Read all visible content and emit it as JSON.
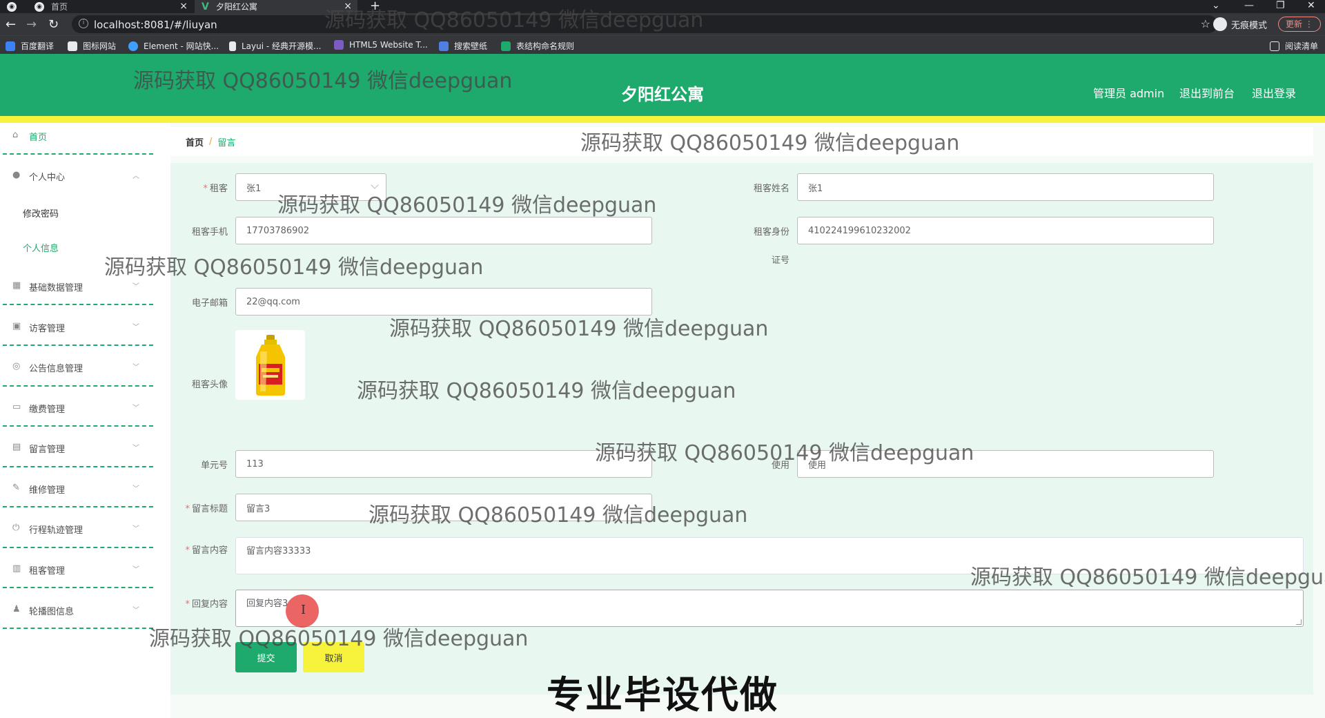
{
  "browser": {
    "tabs": [
      {
        "label": "首页",
        "icon": "globe-icon"
      },
      {
        "label": "夕阳红公寓",
        "icon": "vue-icon"
      }
    ],
    "url": "localhost:8081/#/liuyan",
    "incognito_label": "无痕模式",
    "update_label": "更新",
    "bookmarks": [
      {
        "label": "百度翻译",
        "color": "#3b82f6"
      },
      {
        "label": "图标网站",
        "color": "#e8eaed"
      },
      {
        "label": "Element - 网站快...",
        "color": "#409eff"
      },
      {
        "label": "Layui - 经典开源模...",
        "color": "#e8eaed"
      },
      {
        "label": "HTML5 Website T...",
        "color": "#7c5cc4"
      },
      {
        "label": "搜索壁纸",
        "color": "#4f7fe3"
      },
      {
        "label": "表结构命名规则",
        "color": "#1daa6c"
      }
    ],
    "reading_list": "阅读清单"
  },
  "header": {
    "title": "夕阳红公寓",
    "admin_label": "管理员 admin",
    "to_front_label": "退出到前台",
    "logout_label": "退出登录"
  },
  "sidebar": {
    "items": [
      {
        "label": "首页",
        "icon": "home-icon"
      },
      {
        "label": "个人中心",
        "icon": "user-icon"
      },
      {
        "label": "基础数据管理",
        "icon": "grid-icon"
      },
      {
        "label": "访客管理",
        "icon": "clipboard-icon"
      },
      {
        "label": "公告信息管理",
        "icon": "compass-icon"
      },
      {
        "label": "缴费管理",
        "icon": "chat-icon"
      },
      {
        "label": "留言管理",
        "icon": "printer-icon"
      },
      {
        "label": "维修管理",
        "icon": "edit-icon"
      },
      {
        "label": "行程轨迹管理",
        "icon": "power-icon"
      },
      {
        "label": "租客管理",
        "icon": "document-icon"
      },
      {
        "label": "轮播图信息",
        "icon": "person-icon"
      }
    ],
    "submenu": [
      "修改密码",
      "个人信息"
    ]
  },
  "breadcrumb": {
    "home": "首页",
    "separator": "/",
    "current": "留言"
  },
  "form": {
    "zuke": {
      "label": "租客",
      "value": "张1",
      "required": true
    },
    "zuke_name": {
      "label": "租客姓名",
      "value": "张1"
    },
    "zuke_phone": {
      "label": "租客手机",
      "value": "17703786902"
    },
    "zuke_id": {
      "label_line1": "租客身份",
      "label_line2": "证号",
      "value": "410224199610232002"
    },
    "email": {
      "label": "电子邮箱",
      "value": "22@qq.com"
    },
    "avatar": {
      "label": "租客头像"
    },
    "unit": {
      "label": "单元号",
      "value": "113"
    },
    "usage": {
      "label": "使用",
      "value": "使用"
    },
    "msg_title": {
      "label": "留言标题",
      "value": "留言3",
      "required": true
    },
    "msg_content": {
      "label": "留言内容",
      "value": "留言内容33333",
      "required": true
    },
    "reply_content": {
      "label": "回复内容",
      "value": "回复内容3",
      "required": true
    },
    "submit_label": "提交",
    "cancel_label": "取消"
  },
  "watermark_text": "源码获取 QQ86050149 微信deepguan",
  "watermark_text_cut": "源码获取 QQ86050149 微信deepgua",
  "banner_text": "专业毕设代做",
  "colors": {
    "primary": "#1daa6c",
    "accent": "#f7f33c",
    "required": "#f56c6c"
  }
}
